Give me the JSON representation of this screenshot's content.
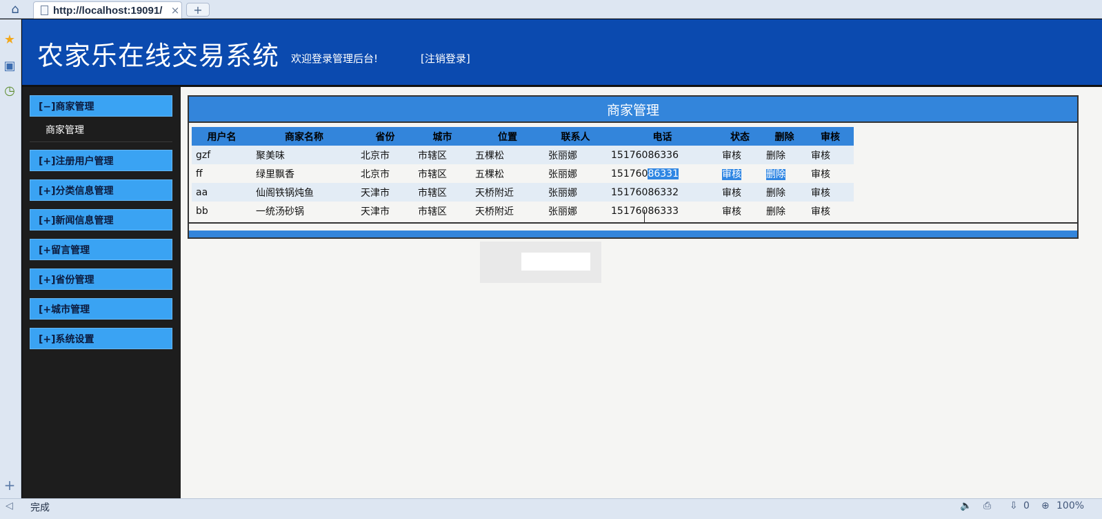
{
  "browser": {
    "tab_title": "http://localhost:19091/",
    "tab_close": "×",
    "new_tab": "+",
    "status_text": "完成",
    "status_zoom": "100%",
    "status_count": "0"
  },
  "header": {
    "title": "农家乐在线交易系统",
    "welcome": "欢迎登录管理后台!",
    "logout": "[注销登录]"
  },
  "sidebar": {
    "groups": [
      {
        "label": "[−]商家管理",
        "sub": "商家管理"
      },
      {
        "label": "[+]注册用户管理"
      },
      {
        "label": "[+]分类信息管理"
      },
      {
        "label": "[+]新闻信息管理"
      },
      {
        "label": "[+留言管理"
      },
      {
        "label": "[+]省份管理"
      },
      {
        "label": "[+城市管理"
      },
      {
        "label": "[+]系统设置"
      }
    ]
  },
  "main": {
    "title": "商家管理",
    "columns": [
      "用户名",
      "商家名称",
      "省份",
      "城市",
      "位置",
      "联系人",
      "电话",
      "状态",
      "删除",
      "审核"
    ],
    "rows": [
      {
        "username": "gzf",
        "merchant": "聚美味",
        "province": "北京市",
        "city": "市辖区",
        "location": "五棵松",
        "contact": "张丽娜",
        "phone": "15176086336",
        "status": "审核",
        "delete": "删除",
        "audit": "审核"
      },
      {
        "username": "ff",
        "merchant": "绿里飘香",
        "province": "北京市",
        "city": "市辖区",
        "location": "五棵松",
        "contact": "张丽娜",
        "phone_a": "151760",
        "phone_b": "86331",
        "status": "审核",
        "delete": "删除",
        "audit": "审核"
      },
      {
        "username": "aa",
        "merchant": "仙阁铁锅炖鱼",
        "province": "天津市",
        "city": "市辖区",
        "location": "天桥附近",
        "contact": "张丽娜",
        "phone": "15176086332",
        "status": "审核",
        "delete": "删除",
        "audit": "审核"
      },
      {
        "username": "bb",
        "merchant": "一统汤砂锅",
        "province": "天津市",
        "city": "市辖区",
        "location": "天桥附近",
        "contact": "张丽娜",
        "phone": "15176086333",
        "status": "审核",
        "delete": "删除",
        "audit": "审核"
      }
    ]
  },
  "colors": {
    "header_bg": "#0b4aaf",
    "menu_bg": "#3aa3f3",
    "table_header_bg": "#3385db",
    "sidebar_bg": "#1d1d1d"
  }
}
